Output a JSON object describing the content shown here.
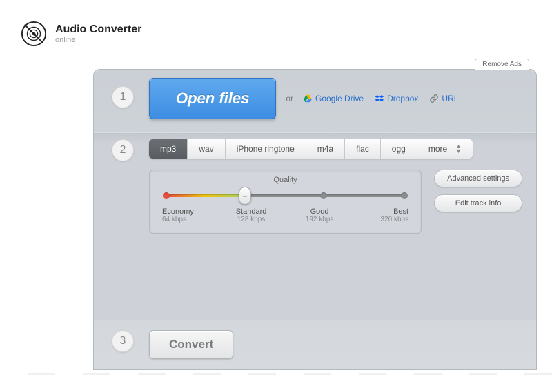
{
  "header": {
    "title": "Audio Converter",
    "subtitle": "online"
  },
  "remove_ads": "Remove Ads",
  "step_labels": {
    "one": "1",
    "two": "2",
    "three": "3"
  },
  "open": {
    "button": "Open files",
    "or": "or",
    "google_drive": "Google Drive",
    "dropbox": "Dropbox",
    "url": "URL"
  },
  "formats": {
    "items": [
      "mp3",
      "wav",
      "iPhone ringtone",
      "m4a",
      "flac",
      "ogg",
      "more"
    ],
    "active_index": 0
  },
  "quality": {
    "title": "Quality",
    "stops": [
      {
        "label": "Economy",
        "sub": "64 kbps"
      },
      {
        "label": "Standard",
        "sub": "128 kbps"
      },
      {
        "label": "Good",
        "sub": "192 kbps"
      },
      {
        "label": "Best",
        "sub": "320 kbps"
      }
    ],
    "selected_index": 1
  },
  "side": {
    "advanced": "Advanced settings",
    "edit_track": "Edit track info"
  },
  "convert": "Convert"
}
